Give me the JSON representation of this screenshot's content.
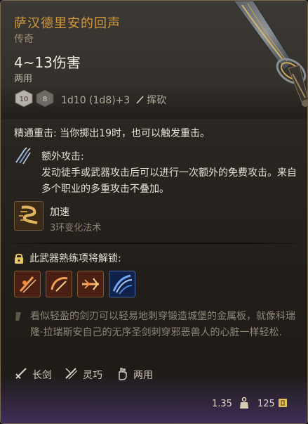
{
  "item": {
    "name": "萨汉德里安的回声",
    "rarity": "传奇",
    "damage": "4~13伤害",
    "handedness": "两用",
    "damage_dice": "1d10 (1d8)+3",
    "damage_type": "挥砍",
    "dice_faces": [
      "10",
      "8"
    ]
  },
  "properties": {
    "critical": "精通重击: 当你掷出19时，也可以触发重击。",
    "extra_attack": {
      "title": "额外攻击:",
      "description": "发动徒手或武器攻击后可以进行一次额外的免费攻击。来自多个职业的多重攻击不叠加。"
    },
    "spell": {
      "name": "加速",
      "level": "3环变化法术"
    }
  },
  "proficiency": {
    "header": "此武器熟练项将解锁:",
    "icons": [
      "proficiency-action-1-icon",
      "proficiency-action-2-icon",
      "proficiency-action-3-icon",
      "proficiency-action-4-icon"
    ]
  },
  "lore": "看似轻盈的剑刃可以轻易地刺穿锻造城堡的金属板，就像科瑞隆·拉瑞斯安自己的无序圣剑刺穿邪恶兽人的心脏一样轻松.",
  "tags": [
    {
      "icon": "longsword-icon",
      "label": "长剑"
    },
    {
      "icon": "finesse-icon",
      "label": "灵巧"
    },
    {
      "icon": "versatile-hand-icon",
      "label": "两用"
    }
  ],
  "footer": {
    "weight": "1.35",
    "price": "125"
  },
  "colors": {
    "title": "#d49b3c",
    "background": "#1b1815",
    "border": "#7a6a52",
    "footer_glow": "#583e8c"
  }
}
